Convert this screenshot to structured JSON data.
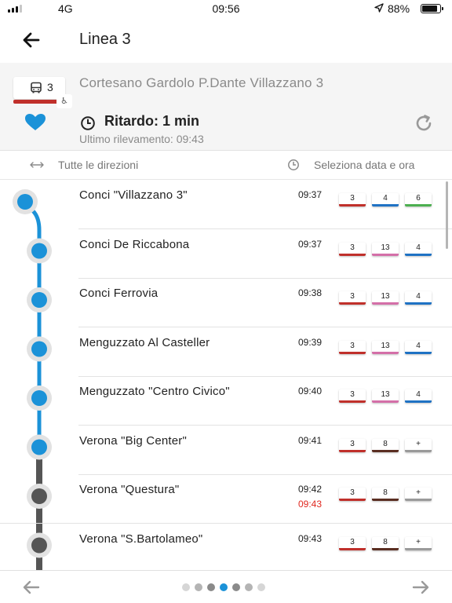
{
  "status_bar": {
    "network": "4G",
    "time": "09:56",
    "battery": "88%",
    "battery_level": 0.88
  },
  "app_bar": {
    "title": "Linea 3",
    "back_icon": "arrow-left-icon"
  },
  "header": {
    "route_number": "3",
    "route_color": "#c0302b",
    "headsign": "Cortesano Gardolo P.Dante Villazzano 3",
    "delay": "Ritardo: 1 min",
    "last_update": "Ultimo rilevamento: 09:43",
    "favorite_color": "#1b92d8"
  },
  "filters": {
    "direction": "Tutte le direzioni",
    "date": "Seleziona data e ora"
  },
  "colors": {
    "line_passed": "#1b92d8",
    "line_upcoming": "#555555",
    "red_time": "#e0281f"
  },
  "stops": [
    {
      "name": "Conci \"Villazzano 3\"",
      "time": "09:37",
      "status": "passed",
      "lines": [
        {
          "label": "3",
          "color": "#c0302b"
        },
        {
          "label": "4",
          "color": "#1f72c4"
        },
        {
          "label": "6",
          "color": "#4caf50"
        }
      ]
    },
    {
      "name": "Conci De Riccabona",
      "time": "09:37",
      "status": "passed",
      "lines": [
        {
          "label": "3",
          "color": "#c0302b"
        },
        {
          "label": "13",
          "color": "#d46fa8"
        },
        {
          "label": "4",
          "color": "#1f72c4"
        }
      ]
    },
    {
      "name": "Conci Ferrovia",
      "time": "09:38",
      "status": "passed",
      "lines": [
        {
          "label": "3",
          "color": "#c0302b"
        },
        {
          "label": "13",
          "color": "#d46fa8"
        },
        {
          "label": "4",
          "color": "#1f72c4"
        }
      ]
    },
    {
      "name": "Menguzzato Al Casteller",
      "time": "09:39",
      "status": "passed",
      "lines": [
        {
          "label": "3",
          "color": "#c0302b"
        },
        {
          "label": "13",
          "color": "#d46fa8"
        },
        {
          "label": "4",
          "color": "#1f72c4"
        }
      ]
    },
    {
      "name": "Menguzzato \"Centro Civico\"",
      "time": "09:40",
      "status": "passed",
      "lines": [
        {
          "label": "3",
          "color": "#c0302b"
        },
        {
          "label": "13",
          "color": "#d46fa8"
        },
        {
          "label": "4",
          "color": "#1f72c4"
        }
      ]
    },
    {
      "name": "Verona \"Big Center\"",
      "time": "09:41",
      "status": "passed",
      "lines": [
        {
          "label": "3",
          "color": "#c0302b"
        },
        {
          "label": "8",
          "color": "#5a2e22"
        },
        {
          "label": "+",
          "color": "#9a9a9a"
        }
      ]
    },
    {
      "name": "Verona \"Questura\"",
      "time": "09:42",
      "realtime": "09:43",
      "status": "upcoming",
      "lines": [
        {
          "label": "3",
          "color": "#c0302b"
        },
        {
          "label": "8",
          "color": "#5a2e22"
        },
        {
          "label": "+",
          "color": "#9a9a9a"
        }
      ]
    },
    {
      "name": "Verona \"S.Bartolameo\"",
      "time": "09:43",
      "status": "upcoming",
      "lines": [
        {
          "label": "3",
          "color": "#c0302b"
        },
        {
          "label": "8",
          "color": "#5a2e22"
        },
        {
          "label": "+",
          "color": "#9a9a9a"
        }
      ]
    }
  ],
  "pager": {
    "dots": [
      {
        "color": "#d6d6d6",
        "active": false
      },
      {
        "color": "#b4b4b4",
        "active": false
      },
      {
        "color": "#8a8a8a",
        "active": false
      },
      {
        "color": "#1b92d8",
        "active": true
      },
      {
        "color": "#8a8a8a",
        "active": false
      },
      {
        "color": "#b4b4b4",
        "active": false
      },
      {
        "color": "#d6d6d6",
        "active": false
      }
    ]
  }
}
